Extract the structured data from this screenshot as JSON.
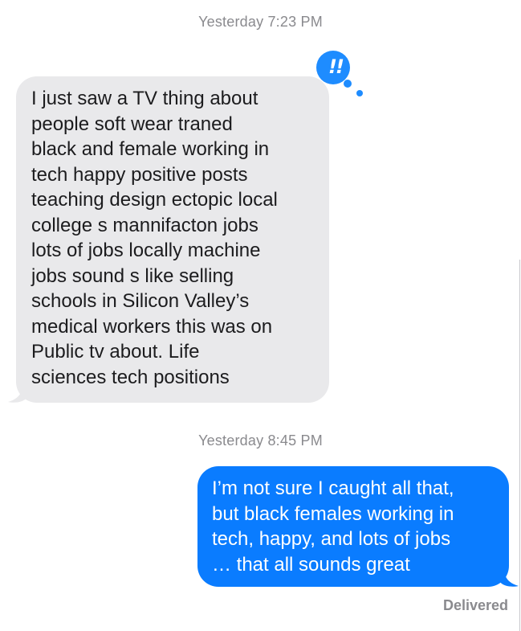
{
  "conversation": {
    "messages": [
      {
        "timestamp": "Yesterday 7:23 PM",
        "sender": "incoming",
        "text": "I  just saw a TV thing about\npeople soft wear traned\nblack and female working  in\ntech happy positive posts\nteaching design ectopic local\ncollege s  mannifacton jobs\nlots of jobs  locally machine\njobs sound s like selling\nschools in Silicon Valley’s\nmedical workers this was on\nPublic tv about.  Life\nsciences tech positions",
        "tapback": "!!"
      },
      {
        "timestamp": "Yesterday 8:45 PM",
        "sender": "outgoing",
        "text": "I’m not sure I caught all that,\nbut black females working in\ntech, happy, and lots of jobs\n… that all sounds great",
        "status": "Delivered"
      }
    ]
  },
  "colors": {
    "incoming_bubble": "#e9e9eb",
    "outgoing_bubble": "#0a7cff",
    "tapback_badge": "#1e8cff",
    "timestamp_text": "#8a8a8e"
  },
  "icons": {
    "tapback": "emphasis-double-exclamation-icon"
  }
}
